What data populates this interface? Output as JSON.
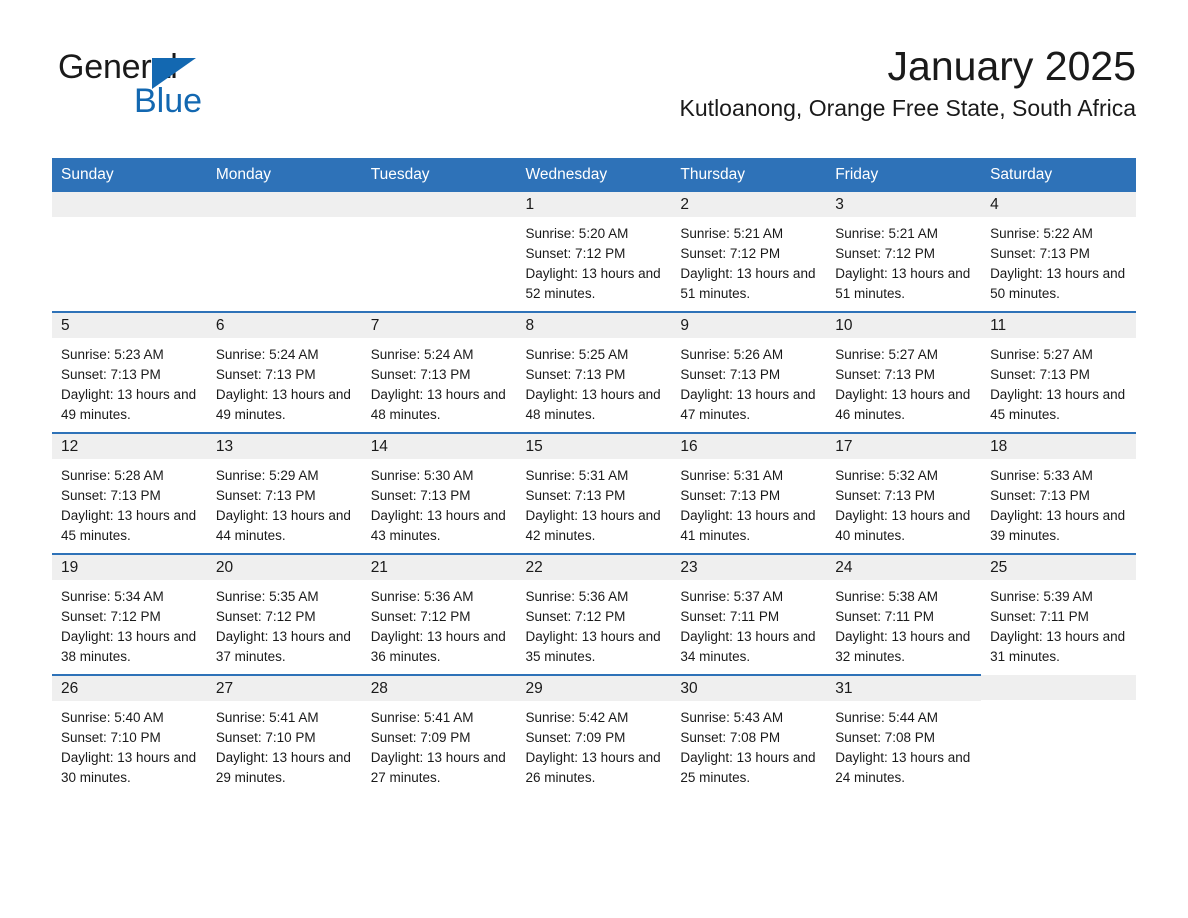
{
  "brand": {
    "name_part1": "General",
    "name_part2": "Blue",
    "triangle_color": "#1368b1",
    "accent_color": "#2e72b8"
  },
  "header": {
    "month_title": "January 2025",
    "location": "Kutloanong, Orange Free State, South Africa"
  },
  "calendar": {
    "weekday_headers": [
      "Sunday",
      "Monday",
      "Tuesday",
      "Wednesday",
      "Thursday",
      "Friday",
      "Saturday"
    ],
    "labels": {
      "sunrise": "Sunrise:",
      "sunset": "Sunset:",
      "daylight": "Daylight:"
    },
    "weeks": [
      [
        {
          "day": "",
          "empty": true
        },
        {
          "day": "",
          "empty": true
        },
        {
          "day": "",
          "empty": true
        },
        {
          "day": "1",
          "sunrise": "Sunrise: 5:20 AM",
          "sunset": "Sunset: 7:12 PM",
          "daylight": "Daylight: 13 hours and 52 minutes."
        },
        {
          "day": "2",
          "sunrise": "Sunrise: 5:21 AM",
          "sunset": "Sunset: 7:12 PM",
          "daylight": "Daylight: 13 hours and 51 minutes."
        },
        {
          "day": "3",
          "sunrise": "Sunrise: 5:21 AM",
          "sunset": "Sunset: 7:12 PM",
          "daylight": "Daylight: 13 hours and 51 minutes."
        },
        {
          "day": "4",
          "sunrise": "Sunrise: 5:22 AM",
          "sunset": "Sunset: 7:13 PM",
          "daylight": "Daylight: 13 hours and 50 minutes."
        }
      ],
      [
        {
          "day": "5",
          "sunrise": "Sunrise: 5:23 AM",
          "sunset": "Sunset: 7:13 PM",
          "daylight": "Daylight: 13 hours and 49 minutes."
        },
        {
          "day": "6",
          "sunrise": "Sunrise: 5:24 AM",
          "sunset": "Sunset: 7:13 PM",
          "daylight": "Daylight: 13 hours and 49 minutes."
        },
        {
          "day": "7",
          "sunrise": "Sunrise: 5:24 AM",
          "sunset": "Sunset: 7:13 PM",
          "daylight": "Daylight: 13 hours and 48 minutes."
        },
        {
          "day": "8",
          "sunrise": "Sunrise: 5:25 AM",
          "sunset": "Sunset: 7:13 PM",
          "daylight": "Daylight: 13 hours and 48 minutes."
        },
        {
          "day": "9",
          "sunrise": "Sunrise: 5:26 AM",
          "sunset": "Sunset: 7:13 PM",
          "daylight": "Daylight: 13 hours and 47 minutes."
        },
        {
          "day": "10",
          "sunrise": "Sunrise: 5:27 AM",
          "sunset": "Sunset: 7:13 PM",
          "daylight": "Daylight: 13 hours and 46 minutes."
        },
        {
          "day": "11",
          "sunrise": "Sunrise: 5:27 AM",
          "sunset": "Sunset: 7:13 PM",
          "daylight": "Daylight: 13 hours and 45 minutes."
        }
      ],
      [
        {
          "day": "12",
          "sunrise": "Sunrise: 5:28 AM",
          "sunset": "Sunset: 7:13 PM",
          "daylight": "Daylight: 13 hours and 45 minutes."
        },
        {
          "day": "13",
          "sunrise": "Sunrise: 5:29 AM",
          "sunset": "Sunset: 7:13 PM",
          "daylight": "Daylight: 13 hours and 44 minutes."
        },
        {
          "day": "14",
          "sunrise": "Sunrise: 5:30 AM",
          "sunset": "Sunset: 7:13 PM",
          "daylight": "Daylight: 13 hours and 43 minutes."
        },
        {
          "day": "15",
          "sunrise": "Sunrise: 5:31 AM",
          "sunset": "Sunset: 7:13 PM",
          "daylight": "Daylight: 13 hours and 42 minutes."
        },
        {
          "day": "16",
          "sunrise": "Sunrise: 5:31 AM",
          "sunset": "Sunset: 7:13 PM",
          "daylight": "Daylight: 13 hours and 41 minutes."
        },
        {
          "day": "17",
          "sunrise": "Sunrise: 5:32 AM",
          "sunset": "Sunset: 7:13 PM",
          "daylight": "Daylight: 13 hours and 40 minutes."
        },
        {
          "day": "18",
          "sunrise": "Sunrise: 5:33 AM",
          "sunset": "Sunset: 7:13 PM",
          "daylight": "Daylight: 13 hours and 39 minutes."
        }
      ],
      [
        {
          "day": "19",
          "sunrise": "Sunrise: 5:34 AM",
          "sunset": "Sunset: 7:12 PM",
          "daylight": "Daylight: 13 hours and 38 minutes."
        },
        {
          "day": "20",
          "sunrise": "Sunrise: 5:35 AM",
          "sunset": "Sunset: 7:12 PM",
          "daylight": "Daylight: 13 hours and 37 minutes."
        },
        {
          "day": "21",
          "sunrise": "Sunrise: 5:36 AM",
          "sunset": "Sunset: 7:12 PM",
          "daylight": "Daylight: 13 hours and 36 minutes."
        },
        {
          "day": "22",
          "sunrise": "Sunrise: 5:36 AM",
          "sunset": "Sunset: 7:12 PM",
          "daylight": "Daylight: 13 hours and 35 minutes."
        },
        {
          "day": "23",
          "sunrise": "Sunrise: 5:37 AM",
          "sunset": "Sunset: 7:11 PM",
          "daylight": "Daylight: 13 hours and 34 minutes."
        },
        {
          "day": "24",
          "sunrise": "Sunrise: 5:38 AM",
          "sunset": "Sunset: 7:11 PM",
          "daylight": "Daylight: 13 hours and 32 minutes."
        },
        {
          "day": "25",
          "sunrise": "Sunrise: 5:39 AM",
          "sunset": "Sunset: 7:11 PM",
          "daylight": "Daylight: 13 hours and 31 minutes."
        }
      ],
      [
        {
          "day": "26",
          "sunrise": "Sunrise: 5:40 AM",
          "sunset": "Sunset: 7:10 PM",
          "daylight": "Daylight: 13 hours and 30 minutes."
        },
        {
          "day": "27",
          "sunrise": "Sunrise: 5:41 AM",
          "sunset": "Sunset: 7:10 PM",
          "daylight": "Daylight: 13 hours and 29 minutes."
        },
        {
          "day": "28",
          "sunrise": "Sunrise: 5:41 AM",
          "sunset": "Sunset: 7:09 PM",
          "daylight": "Daylight: 13 hours and 27 minutes."
        },
        {
          "day": "29",
          "sunrise": "Sunrise: 5:42 AM",
          "sunset": "Sunset: 7:09 PM",
          "daylight": "Daylight: 13 hours and 26 minutes."
        },
        {
          "day": "30",
          "sunrise": "Sunrise: 5:43 AM",
          "sunset": "Sunset: 7:08 PM",
          "daylight": "Daylight: 13 hours and 25 minutes."
        },
        {
          "day": "31",
          "sunrise": "Sunrise: 5:44 AM",
          "sunset": "Sunset: 7:08 PM",
          "daylight": "Daylight: 13 hours and 24 minutes."
        },
        {
          "day": "",
          "empty": true
        }
      ]
    ]
  }
}
